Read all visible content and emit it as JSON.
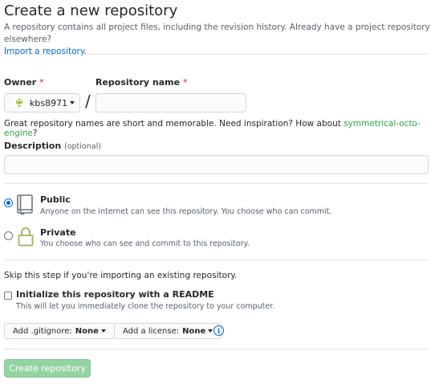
{
  "header": {
    "title": "Create a new repository",
    "subtitle_text": "A repository contains all project files, including the revision history. Already have a project repository elsewhere?",
    "import_link": "Import a repository."
  },
  "owner": {
    "label": "Owner",
    "required_mark": "*",
    "value": "kbs8971"
  },
  "repo_name": {
    "label": "Repository name",
    "required_mark": "*",
    "value": "",
    "separator": "/"
  },
  "hint": {
    "text": "Great repository names are short and memorable. Need inspiration? How about ",
    "suggestion": "symmetrical-octo-engine",
    "end": "?"
  },
  "description": {
    "label": "Description",
    "optional": "(optional)",
    "value": ""
  },
  "visibility": {
    "selected": "public",
    "public": {
      "title": "Public",
      "desc": "Anyone on the internet can see this repository. You choose who can commit."
    },
    "private": {
      "title": "Private",
      "desc": "You choose who can see and commit to this repository."
    }
  },
  "init": {
    "skip_text": "Skip this step if you're importing an existing repository.",
    "readme_label": "Initialize this repository with a README",
    "readme_desc": "This will let you immediately clone the repository to your computer.",
    "readme_checked": false
  },
  "dropdowns": {
    "gitignore_label": "Add .gitignore:",
    "gitignore_value": "None",
    "license_label": "Add a license:",
    "license_value": "None"
  },
  "icons": {
    "info": "i"
  },
  "submit": {
    "label": "Create repository"
  },
  "colors": {
    "link": "#0366d6",
    "required": "#cb2431",
    "suggestion": "#28a745",
    "create_button_disabled": "#94d3a2"
  }
}
